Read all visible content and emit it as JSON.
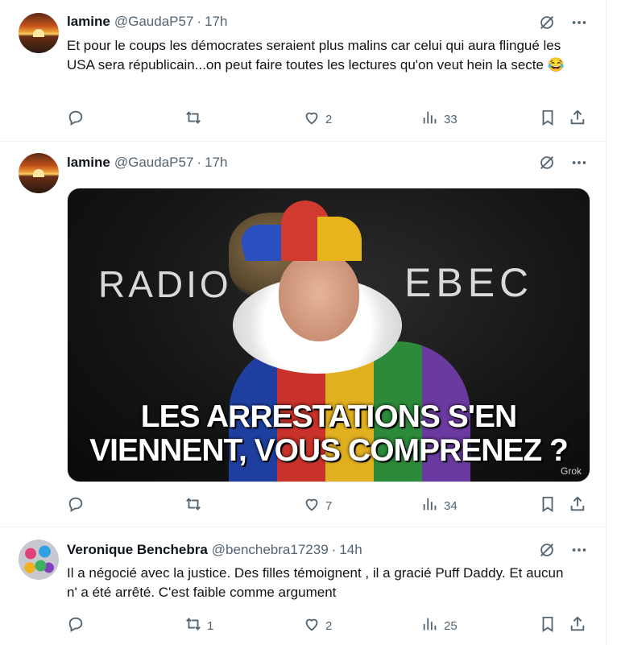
{
  "tweets": [
    {
      "name": "lamine",
      "handle": "@GaudaP57",
      "sep": "·",
      "time": "17h",
      "text": "Et pour le coups les démocrates seraient plus malins car celui qui aura flingué les USA sera républicain...on peut faire toutes les lectures qu'on veut hein la secte 😂",
      "replies": "",
      "retweets": "",
      "likes": "2",
      "views": "33"
    },
    {
      "name": "lamine",
      "handle": "@GaudaP57",
      "sep": "·",
      "time": "17h",
      "media": {
        "logo_left": "RADIO",
        "logo_right": "EBEC",
        "caption_line1": "LES ARRESTATIONS S'EN",
        "caption_line2": "VIENNENT, VOUS COMPRENEZ ?",
        "watermark": "Grok"
      },
      "replies": "",
      "retweets": "",
      "likes": "7",
      "views": "34"
    },
    {
      "name": "Veronique Benchebra",
      "handle": "@benchebra17239",
      "sep": "·",
      "time": "14h",
      "text": "Il a négocié avec la justice. Des filles témoignent , il a gracié Puff Daddy. Et aucun n' a été arrêté. C'est faible comme argument",
      "replies": "",
      "retweets": "1",
      "likes": "2",
      "views": "25"
    }
  ],
  "colors": {
    "secondary": "#536471",
    "text": "#0f1419",
    "border": "#eff3f4"
  },
  "icons": [
    "grok-icon",
    "more-icon",
    "reply-icon",
    "retweet-icon",
    "like-icon",
    "views-icon",
    "bookmark-icon",
    "share-icon"
  ]
}
